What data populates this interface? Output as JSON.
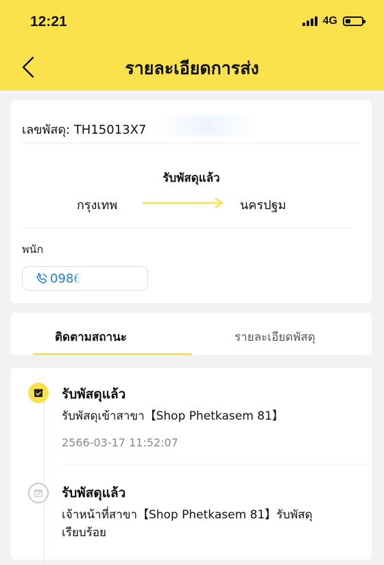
{
  "status_bar": {
    "time": "12:21",
    "network": "4G"
  },
  "header": {
    "title": "รายละเอียดการส่ง"
  },
  "shipment": {
    "tracking_label": "เลขพัสดุ: TH15013X7",
    "status": "รับพัสดุแล้ว",
    "origin": "กรุงเทพ",
    "destination": "นครปฐม",
    "courier_label": "พนัก",
    "phone": "0986"
  },
  "tabs": [
    {
      "label": "ติดตามสถานะ",
      "active": true
    },
    {
      "label": "รายละเอียดพัสดุ",
      "active": false
    }
  ],
  "timeline": [
    {
      "title": "รับพัสดุแล้ว",
      "description": "รับพัสดุเข้าสาขา【Shop Phetkasem 81】",
      "timestamp": "2566-03-17 11:52:07",
      "icon": "box-icon",
      "state": "current"
    },
    {
      "title": "รับพัสดุแล้ว",
      "description": "เจ้าหน้าที่สาขา【Shop Phetkasem 81】รับพัสดุเรียบร้อย",
      "icon": "box-check-icon",
      "state": "past"
    }
  ],
  "colors": {
    "accent": "#fae24c",
    "link": "#1e7be0",
    "background": "#f2f2f2"
  }
}
